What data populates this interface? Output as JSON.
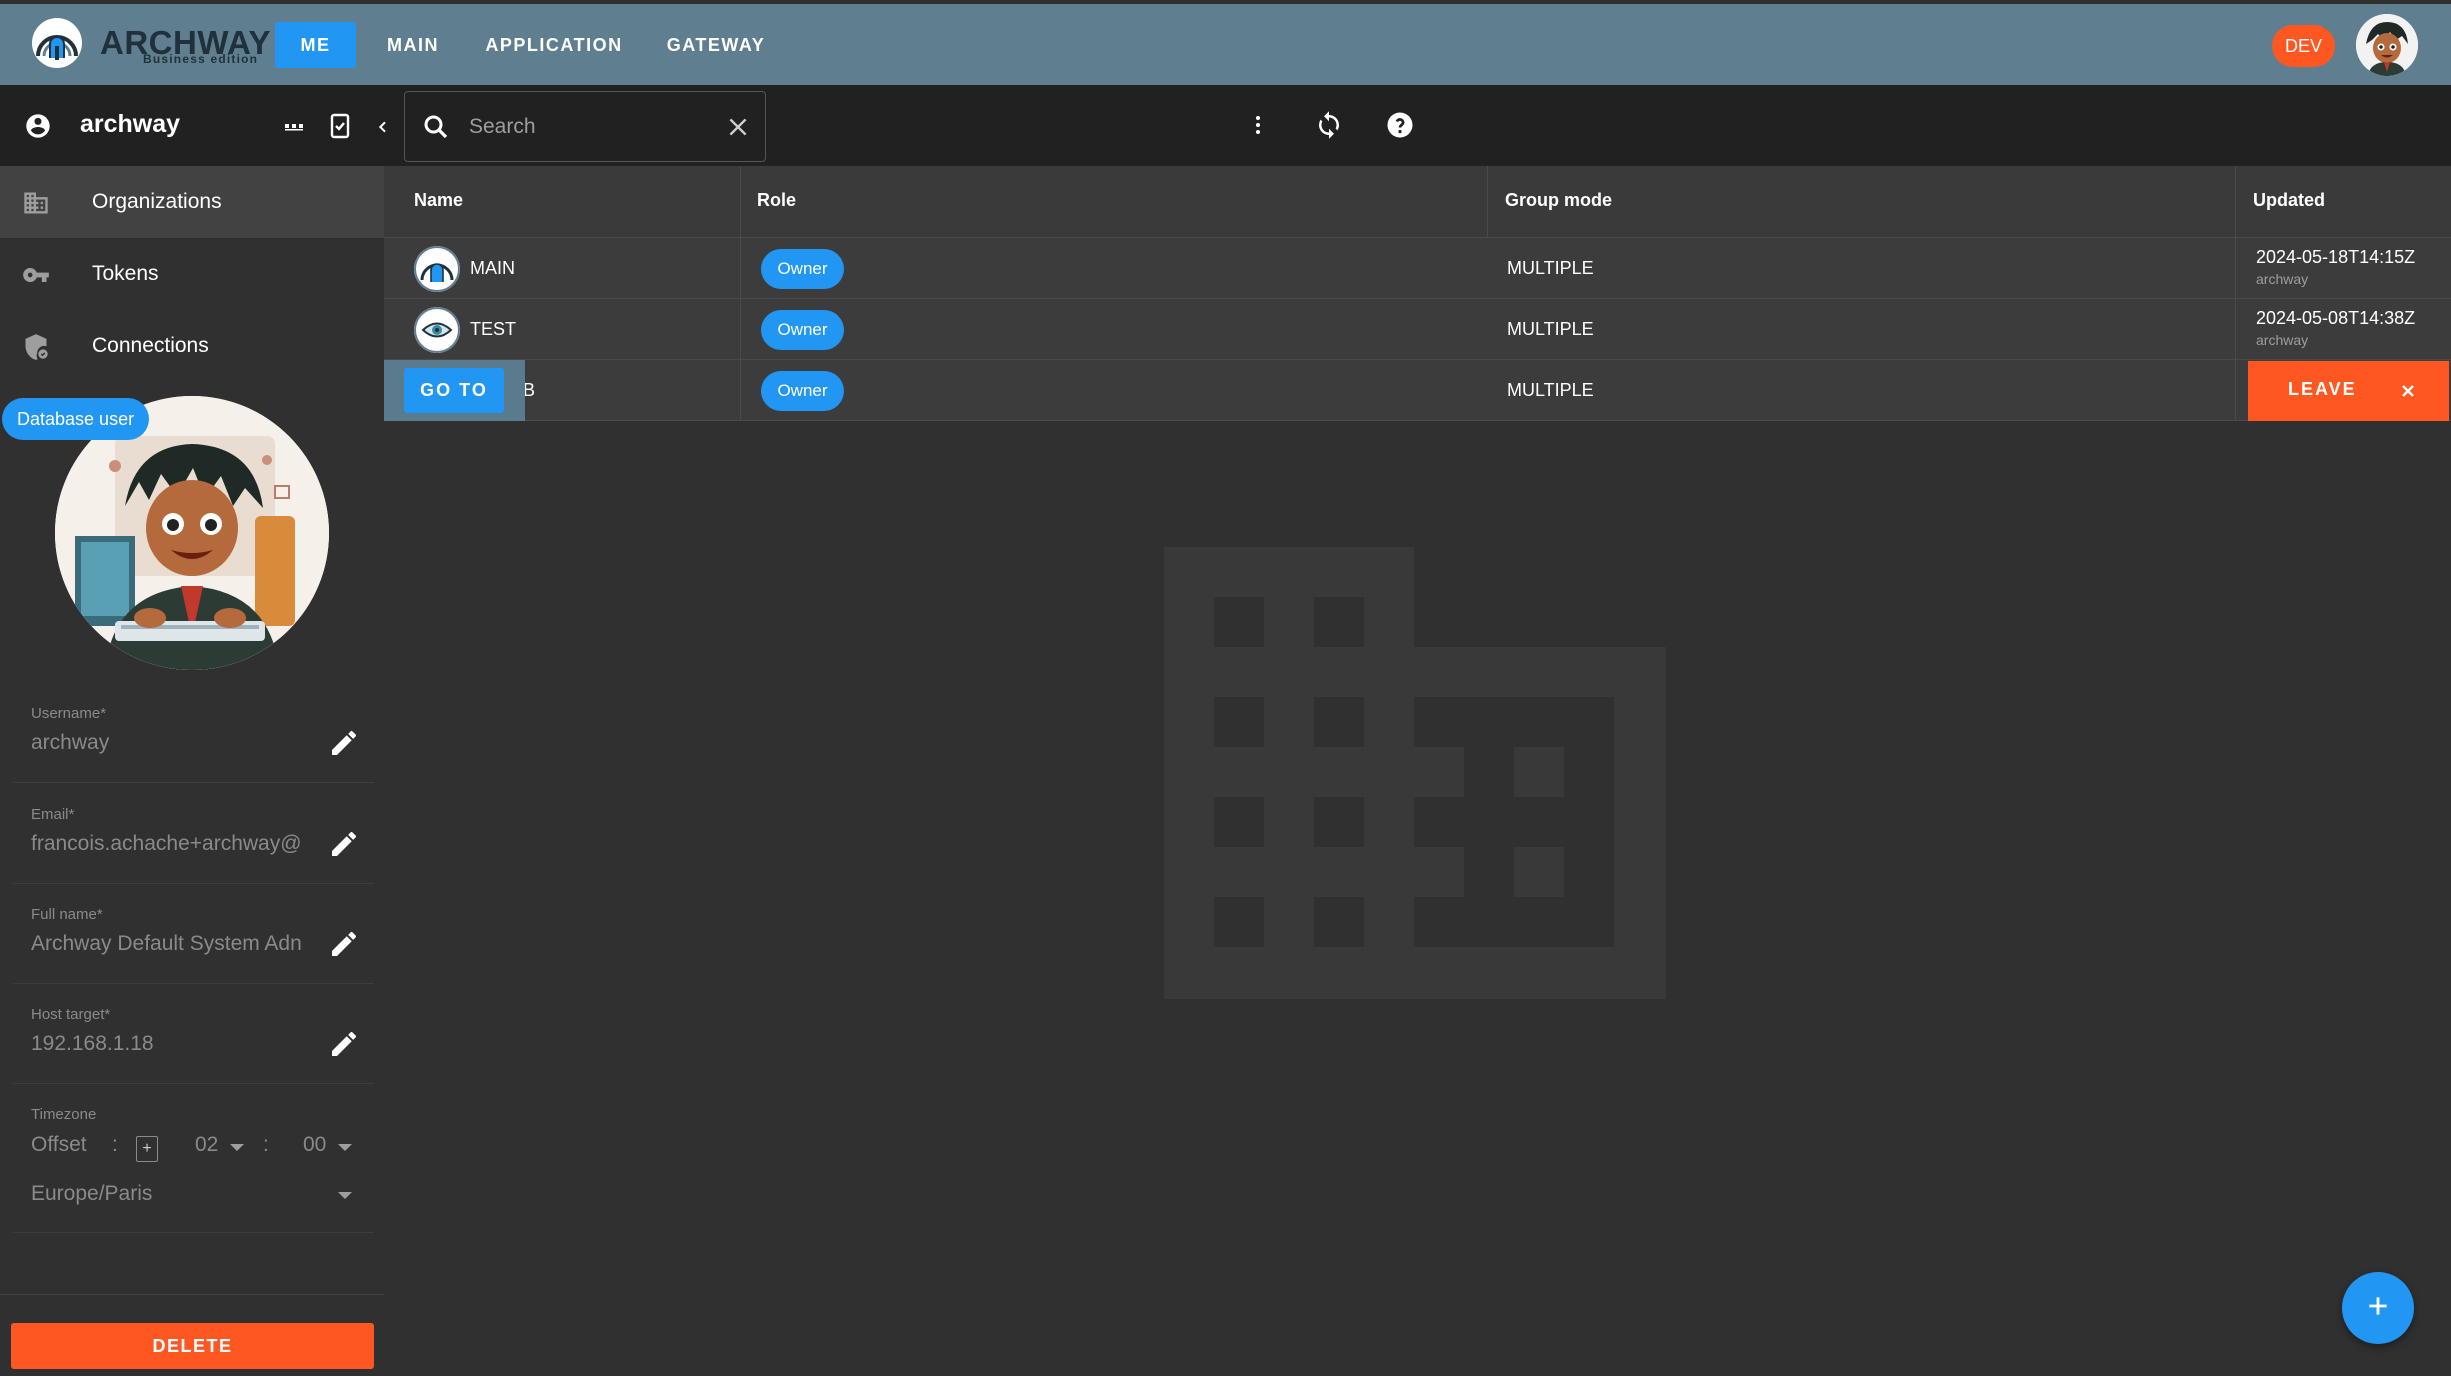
{
  "app": {
    "brand": "ARCHWAY",
    "edition": "Business edition",
    "env_badge": "DEV"
  },
  "nav": {
    "tabs": [
      {
        "label": "ME",
        "active": true
      },
      {
        "label": "MAIN",
        "active": false
      },
      {
        "label": "APPLICATION",
        "active": false
      },
      {
        "label": "GATEWAY",
        "active": false
      }
    ]
  },
  "user": {
    "name": "archway",
    "badge": "Database user"
  },
  "sidebar": {
    "items": [
      {
        "label": "Organizations",
        "icon": "organization-icon",
        "active": true
      },
      {
        "label": "Tokens",
        "icon": "key-icon",
        "active": false
      },
      {
        "label": "Connections",
        "icon": "shield-icon",
        "active": false
      }
    ]
  },
  "profile": {
    "fields": [
      {
        "label": "Username*",
        "value": "archway"
      },
      {
        "label": "Email*",
        "value": "francois.achache+archway@"
      },
      {
        "label": "Full name*",
        "value": "Archway Default System Adn"
      },
      {
        "label": "Host target*",
        "value": "192.168.1.18"
      }
    ],
    "timezone": {
      "label": "Timezone",
      "offset_label": "Offset",
      "separator": ":",
      "sign": "+",
      "hours": "02",
      "minutes": "00",
      "zone": "Europe/Paris"
    },
    "delete_label": "DELETE"
  },
  "search": {
    "placeholder": "Search",
    "value": ""
  },
  "table": {
    "columns": [
      "Name",
      "Role",
      "Group mode",
      "Updated"
    ],
    "rows": [
      {
        "name": "MAIN",
        "role": "Owner",
        "group_mode": "MULTIPLE",
        "updated": "2024-05-18T14:15Z",
        "updated_by": "archway"
      },
      {
        "name": "TEST",
        "role": "Owner",
        "group_mode": "MULTIPLE",
        "updated": "2024-05-08T14:38Z",
        "updated_by": "archway"
      },
      {
        "name": "B",
        "role": "Owner",
        "group_mode": "MULTIPLE",
        "updated": "",
        "updated_by": ""
      }
    ],
    "row_actions": {
      "goto_label": "GO TO",
      "leave_label": "LEAVE"
    }
  },
  "colors": {
    "topbar": "#5f7f91",
    "accent": "#2196f3",
    "danger": "#ff5722",
    "background": "#303030",
    "header": "#212121"
  }
}
